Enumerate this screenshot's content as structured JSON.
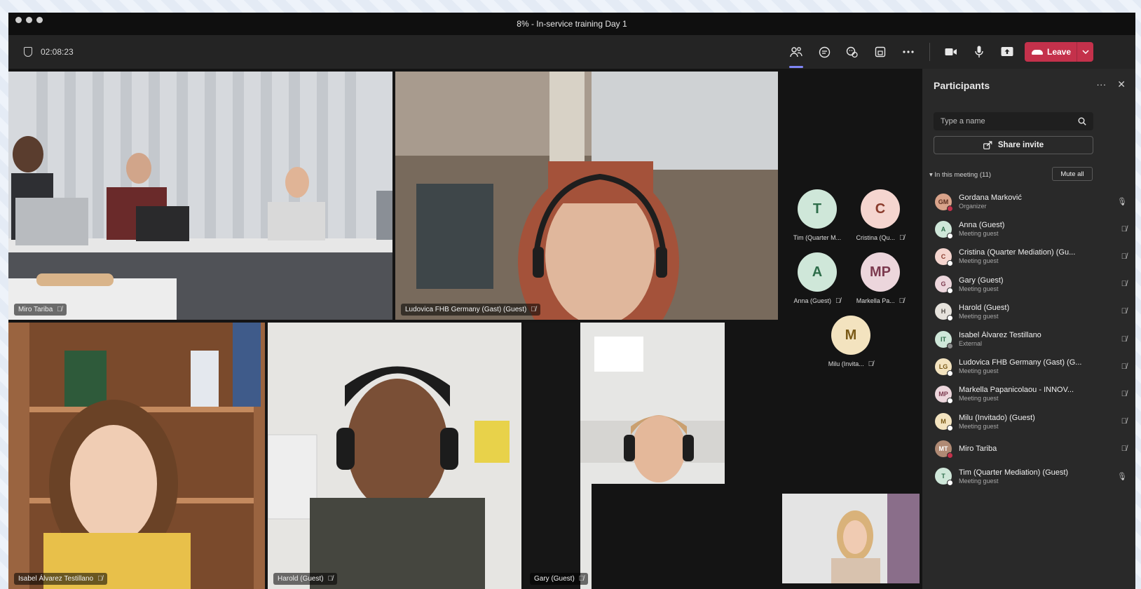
{
  "window": {
    "title": "8% - In-service training Day 1"
  },
  "toolbar": {
    "timer": "02:08:23",
    "icons": [
      "people-icon",
      "chat-icon",
      "reactions-icon",
      "rooms-icon",
      "more-icon",
      "camera-icon",
      "mic-icon",
      "share-icon"
    ],
    "leave_label": "Leave",
    "leave_color": "#c4314b",
    "accent_color": "#7f85f5"
  },
  "tiles": [
    {
      "label": "Miro Tariba"
    },
    {
      "label": "Ludovica FHB Germany (Gast) (Guest)"
    },
    {
      "label": "Isabel Álvarez Testillano"
    },
    {
      "label": "Harold (Guest)"
    },
    {
      "label": "Gary (Guest)"
    }
  ],
  "roster_avatars": [
    {
      "initials": "T",
      "name": "Tim (Quarter M...",
      "bg": "#cfe7d9",
      "fg": "#2e6d4a"
    },
    {
      "initials": "C",
      "name": "Cristina (Qu...",
      "bg": "#f5d5cf",
      "fg": "#8a3b2c"
    },
    {
      "initials": "A",
      "name": "Anna (Guest)",
      "bg": "#cfe7d9",
      "fg": "#2e6d4a"
    },
    {
      "initials": "MP",
      "name": "Markella Pa...",
      "bg": "#ecd6dc",
      "fg": "#7c3a4f"
    },
    {
      "initials": "M",
      "name": "Milu (Invita...",
      "bg": "#f3e3bf",
      "fg": "#7a5a17"
    }
  ],
  "panel": {
    "title": "Participants",
    "search_placeholder": "Type a name",
    "share_label": "Share invite",
    "section_label": "In this meeting (11)",
    "mute_all_label": "Mute all",
    "participants": [
      {
        "name": "Gordana Marković",
        "role": "Organizer",
        "initials": "GM",
        "bg": "#d9a38a",
        "fg": "#5a2e1e",
        "dot": "#c4314b",
        "mic": "on"
      },
      {
        "name": "Anna (Guest)",
        "role": "Meeting guest",
        "initials": "A",
        "bg": "#cfe7d9",
        "fg": "#2e6d4a",
        "dot": "#ffffff",
        "mic": "off"
      },
      {
        "name": "Cristina (Quarter Mediation) (Gu...",
        "role": "Meeting guest",
        "initials": "C",
        "bg": "#f5d5cf",
        "fg": "#8a3b2c",
        "dot": "#ffffff",
        "mic": "off"
      },
      {
        "name": "Gary (Guest)",
        "role": "Meeting guest",
        "initials": "G",
        "bg": "#ecd6dc",
        "fg": "#7c3a4f",
        "dot": "#ffffff",
        "mic": "off"
      },
      {
        "name": "Harold (Guest)",
        "role": "Meeting guest",
        "initials": "H",
        "bg": "#e6e2dc",
        "fg": "#55504a",
        "dot": "#ffffff",
        "mic": "off"
      },
      {
        "name": "Isabel Álvarez Testillano",
        "role": "External",
        "initials": "IT",
        "bg": "#cfe7d9",
        "fg": "#2e6d4a",
        "dot": "#8a8a8a",
        "mic": "off"
      },
      {
        "name": "Ludovica FHB Germany (Gast) (G...",
        "role": "Meeting guest",
        "initials": "LG",
        "bg": "#f3e3bf",
        "fg": "#7a5a17",
        "dot": "#ffffff",
        "mic": "off"
      },
      {
        "name": "Markella Papanicolaou - INNOV...",
        "role": "Meeting guest",
        "initials": "MP",
        "bg": "#ecd6dc",
        "fg": "#7c3a4f",
        "dot": "#ffffff",
        "mic": "off"
      },
      {
        "name": "Milu (Invitado) (Guest)",
        "role": "Meeting guest",
        "initials": "M",
        "bg": "#f3e3bf",
        "fg": "#7a5a17",
        "dot": "#ffffff",
        "mic": "off"
      },
      {
        "name": "Miro Tariba",
        "role": "",
        "initials": "MT",
        "bg": "#b08a74",
        "fg": "#ffffff",
        "dot": "#c4314b",
        "mic": "off"
      },
      {
        "name": "Tim (Quarter Mediation) (Guest)",
        "role": "Meeting guest",
        "initials": "T",
        "bg": "#cfe7d9",
        "fg": "#2e6d4a",
        "dot": "#ffffff",
        "mic": "on"
      }
    ]
  }
}
